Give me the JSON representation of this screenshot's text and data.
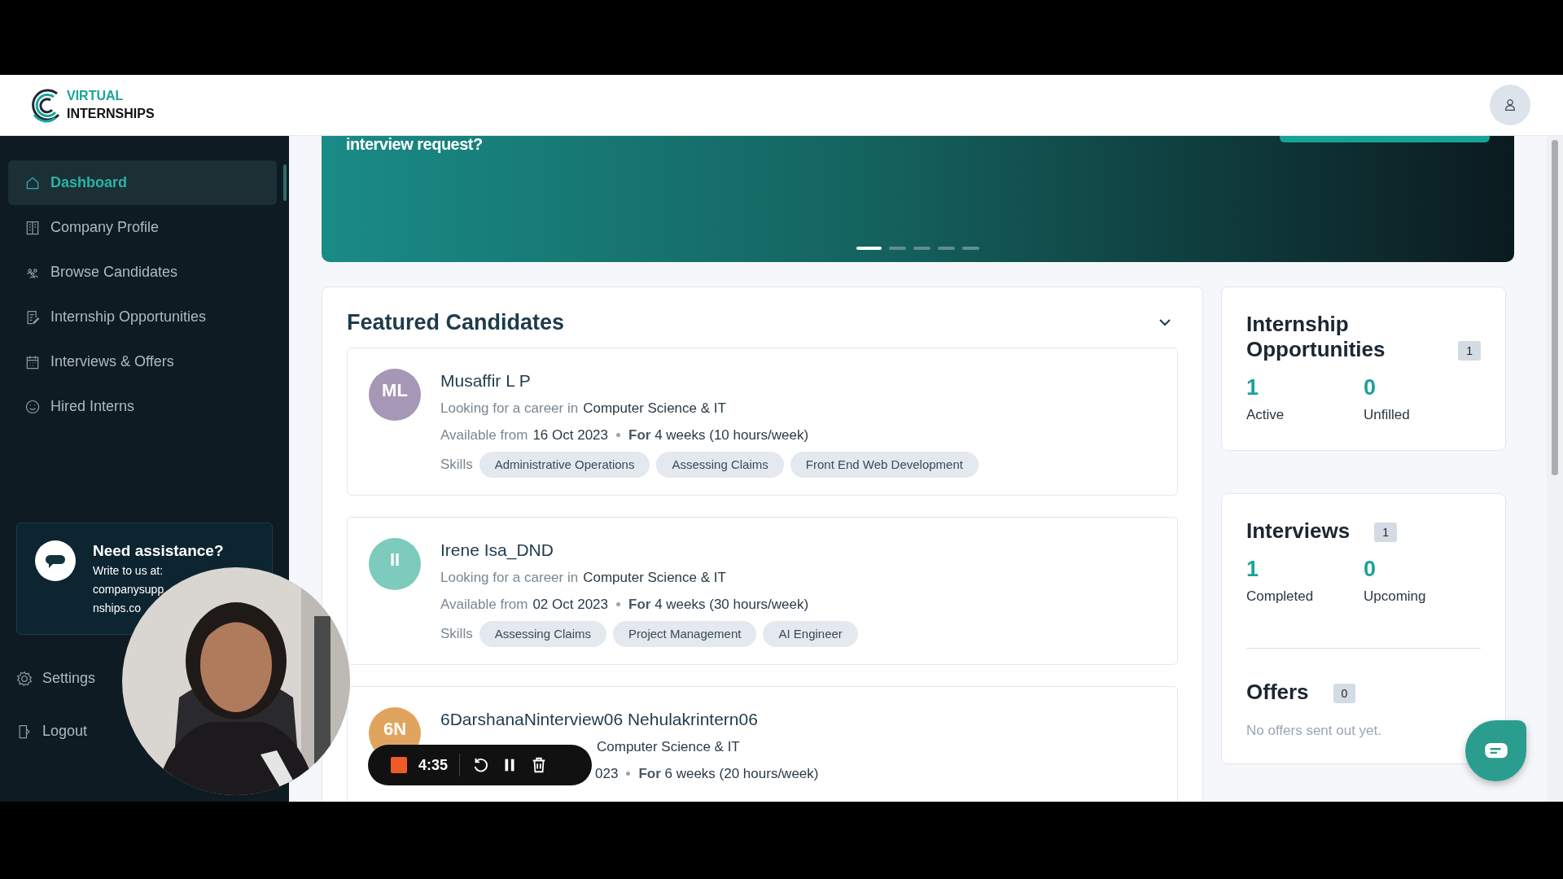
{
  "header": {
    "logo_top": "VIRTUAL",
    "logo_bottom": "INTERNSHIPS"
  },
  "sidebar": {
    "items": [
      {
        "label": "Dashboard",
        "selected": true
      },
      {
        "label": "Company Profile",
        "selected": false
      },
      {
        "label": "Browse Candidates",
        "selected": false
      },
      {
        "label": "Internship Opportunities",
        "selected": false
      },
      {
        "label": "Interviews & Offers",
        "selected": false
      },
      {
        "label": "Hired Interns",
        "selected": false
      }
    ],
    "assistance": {
      "title": "Need assistance?",
      "text": "Write to us at:",
      "email_lines": [
        "companysupp",
        "nships.co"
      ]
    },
    "bottom_items": [
      {
        "label": "Settings"
      },
      {
        "label": "Logout"
      }
    ]
  },
  "banner": {
    "text": "interview request?",
    "slides": [
      {
        "selected": true
      },
      {
        "selected": false
      },
      {
        "selected": false
      },
      {
        "selected": false
      },
      {
        "selected": false
      }
    ]
  },
  "featured": {
    "title": "Featured Candidates",
    "candidates": [
      {
        "initials": "ML",
        "color": "#a597b5",
        "name": "Musaffir L P",
        "career_prefix": "Looking for a career in",
        "career": "Computer Science & IT",
        "available_prefix": "Available from",
        "date": "16 Oct 2023",
        "duration_prefix": "For",
        "duration": "4 weeks (10 hours/week)",
        "skills_label": "Skills",
        "skills": [
          "Administrative Operations",
          "Assessing Claims",
          "Front End Web Development"
        ]
      },
      {
        "initials": "II",
        "color": "#7ccbbd",
        "name": "Irene Isa_DND",
        "career_prefix": "Looking for a career in",
        "career": "Computer Science & IT",
        "available_prefix": "Available from",
        "date": "02 Oct 2023",
        "duration_prefix": "For",
        "duration": "4 weeks (30 hours/week)",
        "skills_label": "Skills",
        "skills": [
          "Assessing Claims",
          "Project Management",
          "AI Engineer"
        ]
      },
      {
        "initials": "6N",
        "color": "#e0a45f",
        "name": "6DarshanaNinterview06 Nehulakrintern06",
        "career": "Computer Science & IT",
        "date": "023",
        "duration_prefix": "For",
        "duration": "6 weeks (20 hours/week)"
      }
    ]
  },
  "cards": [
    {
      "sections": [
        {
          "title": "Internship Opportunities",
          "count": "1",
          "metrics": [
            {
              "value": "1",
              "label": "Active"
            },
            {
              "value": "0",
              "label": "Unfilled"
            }
          ]
        }
      ]
    },
    {
      "sections": [
        {
          "title": "Interviews",
          "count": "1",
          "metrics": [
            {
              "value": "1",
              "label": "Completed"
            },
            {
              "value": "0",
              "label": "Upcoming"
            }
          ]
        },
        {
          "title": "Offers",
          "count": "0",
          "empty_text": "No offers sent out yet."
        }
      ]
    }
  ],
  "recorder": {
    "time": "4:35"
  }
}
